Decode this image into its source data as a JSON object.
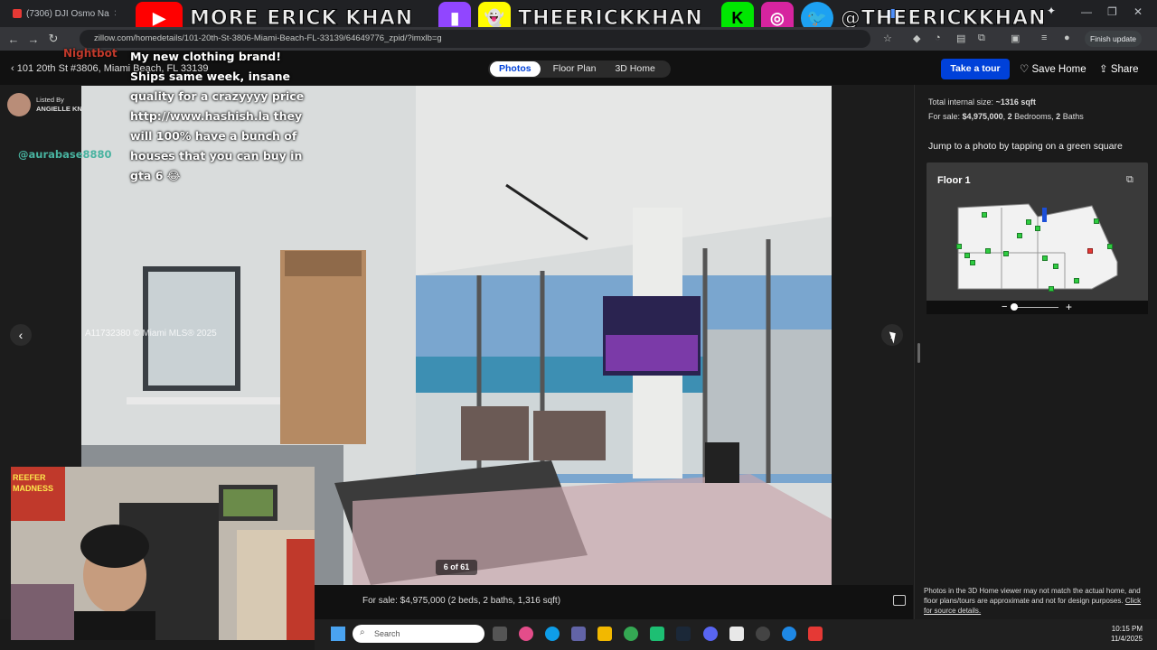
{
  "browser": {
    "tabs": [
      {
        "title": "(7306) DJI Osmo Na"
      },
      {
        "title": "(7306) DJI Osmo Na"
      }
    ],
    "url": "zillow.com/homedetails/101-20th-St-3806-Miami-Beach-FL-33139/64649776_zpid/?imxlb=g",
    "finish_update_label": "Finish update"
  },
  "stream_banner": {
    "handle": "MORE ERICK KHAN",
    "handle_2": "THEERICKKHAN",
    "handle_3": "@THEERICKKHAN"
  },
  "header": {
    "address": "101 20th St #3806, Miami Beach, FL 33139",
    "tabs": [
      {
        "label": "Photos",
        "active": true
      },
      {
        "label": "Floor Plan",
        "active": false
      },
      {
        "label": "3D Home",
        "active": false
      }
    ],
    "tour_button": "Take a tour",
    "save_label": "Save Home",
    "share_label": "Share"
  },
  "listing": {
    "listed_by_label": "Listed By",
    "agent_name": "ANGIELLE KNOWLE",
    "watermark": "A11732380 © Miami MLS® 2025",
    "photo_counter": "6 of 61",
    "caption": "For sale: $4,975,000 (2 beds, 2 baths, 1,316 sqft)"
  },
  "side_panel": {
    "size_label": "Total internal size:",
    "size_value": "~1316 sqft",
    "sale_line_prefix": "For sale:",
    "price": "$4,975,000",
    "beds": "2",
    "beds_label": "Bedrooms,",
    "baths": "2",
    "baths_label": "Baths",
    "jump_text": "Jump to a photo by tapping on a green square",
    "floor_label": "Floor 1",
    "disclaimer": "Photos in the 3D Home viewer may not match the actual home, and floor plans/tours are approximate and not for design purposes.",
    "source_link": "Click for source details."
  },
  "chat": {
    "username": "Nightbot",
    "message": "My new clothing brand! Ships same week, insane quality for a crazyyyy price http://www.hashish.la they will 100% have a bunch of houses that you can buy in gta 6 😂",
    "other_user": "@aurabase8880"
  },
  "webcam": {
    "poster_text_1": "REEFER",
    "poster_text_2": "MADNESS"
  },
  "taskbar": {
    "search_placeholder": "Search",
    "time": "10:15 PM",
    "date": "11/4/2025"
  },
  "colors": {
    "zillow_blue": "#0041d9",
    "green_marker": "#2ecc40",
    "red_marker": "#e53935"
  }
}
